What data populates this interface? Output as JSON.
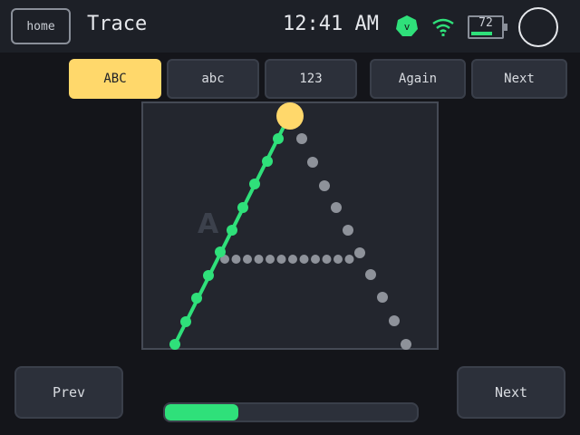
{
  "header": {
    "home_label": "home",
    "title": "Trace",
    "time": "12:41 AM",
    "status_badge": "v",
    "battery_level": "72",
    "battery_fraction": 0.72
  },
  "modes": [
    {
      "label": "ABC",
      "active": true
    },
    {
      "label": "abc",
      "active": false
    },
    {
      "label": "123",
      "active": false
    }
  ],
  "actions": {
    "again_label": "Again",
    "next_label": "Next"
  },
  "canvas": {
    "guide_letter": "A"
  },
  "footer": {
    "prev_label": "Prev",
    "next_label": "Next",
    "progress": 0.29
  },
  "colors": {
    "accent": "#ffd86b",
    "trace": "#2fe07a",
    "guide": "#8e929a",
    "background": "#14151a"
  }
}
